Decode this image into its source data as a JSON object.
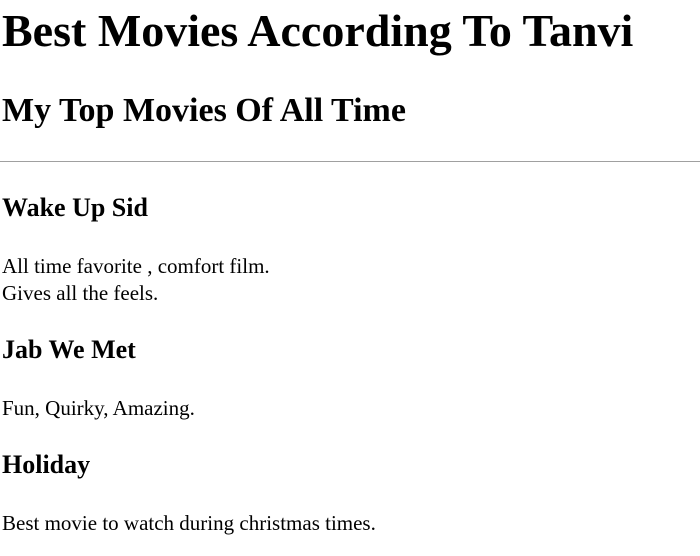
{
  "header": {
    "title": "Best Movies According To Tanvi",
    "subtitle": "My Top Movies Of All Time"
  },
  "movies": [
    {
      "title": "Wake Up Sid",
      "description_lines": [
        "All time favorite , comfort film.",
        "Gives all the feels."
      ]
    },
    {
      "title": "Jab We Met",
      "description_lines": [
        "Fun, Quirky, Amazing."
      ]
    },
    {
      "title": "Holiday",
      "description_lines": [
        "Best movie to watch during christmas times."
      ]
    }
  ]
}
